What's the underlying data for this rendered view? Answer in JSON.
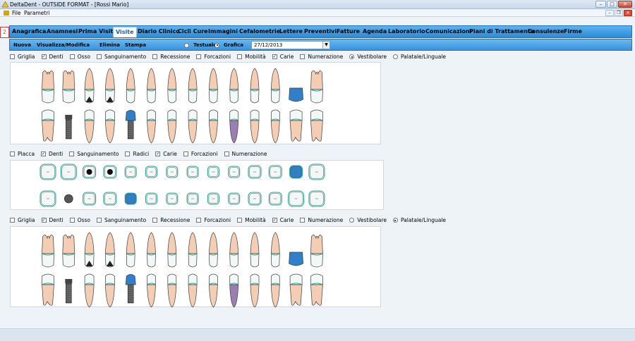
{
  "window": {
    "title": "DeltaDent - OUTSIDE FORMAT - [Rossi Mario]"
  },
  "menu": {
    "items": [
      "File",
      "Parametri"
    ]
  },
  "side_tab": {
    "number": "2"
  },
  "tabs": [
    "Anagrafica",
    "Anamnesi",
    "Prima Visita",
    "Visite",
    "Diario Clinico",
    "Cicli Cure",
    "Immagini",
    "Cefalometrie",
    "Lettere",
    "Preventivi",
    "Fatture",
    "Agenda",
    "Laboratorio",
    "Comunicazioni",
    "Piani di Trattamento",
    "Consulenze",
    "Firme"
  ],
  "active_tab": "Visite",
  "toolbar": {
    "buttons": [
      "Nuova",
      "Visualizza/Modifica",
      "Elimina",
      "Stampa"
    ],
    "view_modes": [
      {
        "label": "Testuale",
        "selected": false
      },
      {
        "label": "Grafica",
        "selected": true
      }
    ],
    "date": "27/12/2013"
  },
  "upper_options": [
    {
      "label": "Griglia",
      "checked": false,
      "kind": "check"
    },
    {
      "label": "Denti",
      "checked": true,
      "kind": "check"
    },
    {
      "label": "Osso",
      "checked": false,
      "kind": "check"
    },
    {
      "label": "Sanguinamento",
      "checked": false,
      "kind": "check"
    },
    {
      "label": "Recessione",
      "checked": false,
      "kind": "check"
    },
    {
      "label": "Forcazioni",
      "checked": false,
      "kind": "check"
    },
    {
      "label": "Mobilità",
      "checked": false,
      "kind": "check"
    },
    {
      "label": "Carie",
      "checked": true,
      "kind": "check"
    },
    {
      "label": "Numerazione",
      "checked": false,
      "kind": "check"
    },
    {
      "label": "Vestibolare",
      "checked": true,
      "kind": "radio"
    },
    {
      "label": "Palatale/Linguale",
      "checked": false,
      "kind": "radio"
    }
  ],
  "occlusal_options": [
    {
      "label": "Placca",
      "checked": false,
      "kind": "check"
    },
    {
      "label": "Denti",
      "checked": true,
      "kind": "check"
    },
    {
      "label": "Sanguinamento",
      "checked": false,
      "kind": "check"
    },
    {
      "label": "Radici",
      "checked": false,
      "kind": "check"
    },
    {
      "label": "Carie",
      "checked": true,
      "kind": "check"
    },
    {
      "label": "Forcazioni",
      "checked": false,
      "kind": "check"
    },
    {
      "label": "Numerazione",
      "checked": false,
      "kind": "check"
    }
  ],
  "lower_options": [
    {
      "label": "Griglia",
      "checked": false,
      "kind": "check"
    },
    {
      "label": "Denti",
      "checked": true,
      "kind": "check"
    },
    {
      "label": "Osso",
      "checked": false,
      "kind": "check"
    },
    {
      "label": "Sanguinamento",
      "checked": false,
      "kind": "check"
    },
    {
      "label": "Recessione",
      "checked": false,
      "kind": "check"
    },
    {
      "label": "Forcazioni",
      "checked": false,
      "kind": "check"
    },
    {
      "label": "Mobilità",
      "checked": false,
      "kind": "check"
    },
    {
      "label": "Carie",
      "checked": true,
      "kind": "check"
    },
    {
      "label": "Numerazione",
      "checked": false,
      "kind": "check"
    },
    {
      "label": "Vestibolare",
      "checked": false,
      "kind": "radio"
    },
    {
      "label": "Palatale/Linguale",
      "checked": true,
      "kind": "radio"
    }
  ],
  "colors": {
    "enamel": "#f2f8f6",
    "root": "#f3cdb4",
    "outline": "#3a3a3a",
    "gum_line": "#2aa89a",
    "caries": "#2f80c9",
    "extraction": "#9a7fb0",
    "implant": "#555555",
    "tab_bar": "#3d9be3"
  },
  "chart": {
    "upper_row": [
      "molar",
      "molar",
      "premolar-dark",
      "premolar-dark",
      "incisor",
      "incisor",
      "incisor",
      "incisor",
      "incisor",
      "incisor",
      "incisor",
      "incisor",
      "crown-caries",
      "molar"
    ],
    "lower_row": [
      "molar",
      "implant",
      "premolar",
      "premolar",
      "implant-caries",
      "incisor",
      "incisor",
      "incisor",
      "incisor",
      "incisor-purple",
      "incisor",
      "incisor",
      "molar",
      "molar"
    ],
    "occlusal_top": [
      "molar",
      "molar",
      "dark-center",
      "dark-center",
      "small",
      "small",
      "small",
      "small",
      "small",
      "small",
      "round",
      "round",
      "blue",
      "molar"
    ],
    "occlusal_bottom": [
      "molar",
      "grey-dot",
      "round",
      "round",
      "blue-small",
      "small",
      "small",
      "small",
      "small",
      "small",
      "round",
      "round",
      "molar",
      "molar"
    ]
  }
}
